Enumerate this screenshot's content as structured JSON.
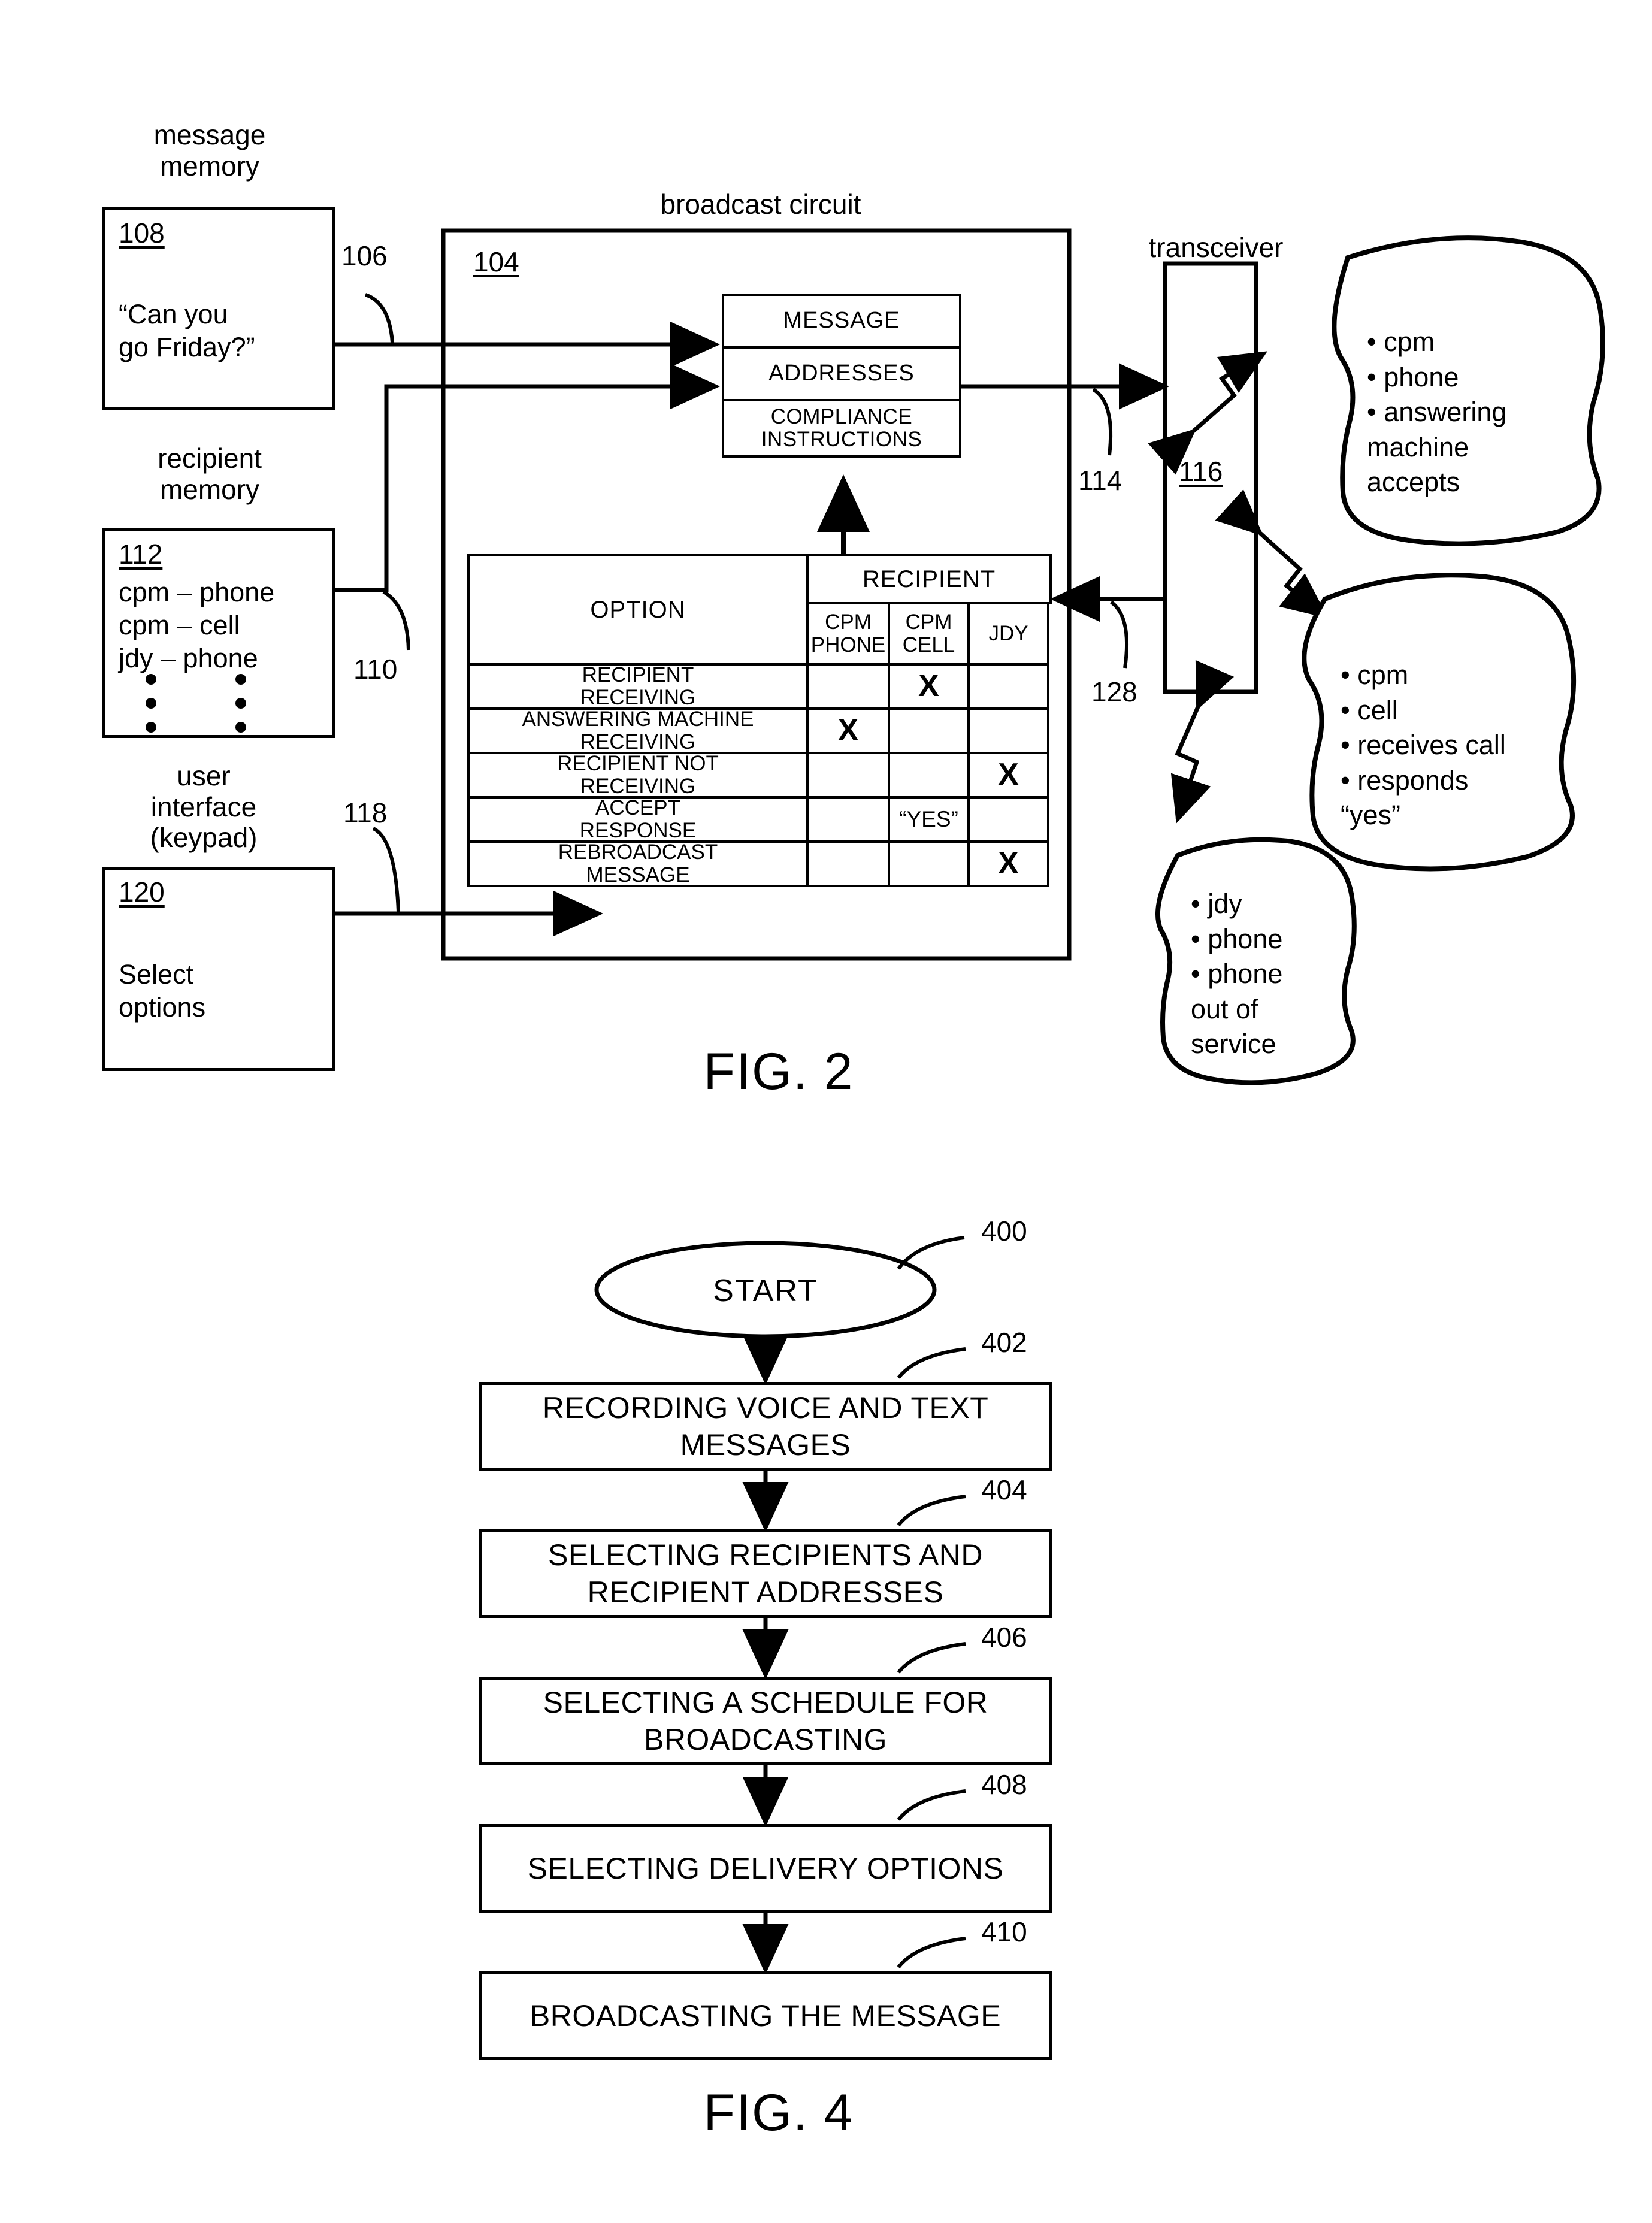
{
  "figures": [
    {
      "caption": "FIG. 2"
    },
    {
      "caption": "FIG. 4"
    }
  ],
  "fig2": {
    "caption": "FIG. 2",
    "message_memory": {
      "title": "message\nmemory",
      "ref": "108",
      "content": "“Can you\ngo Friday?”"
    },
    "recipient_memory": {
      "title": "recipient\nmemory",
      "ref": "112",
      "content": "cpm – phone\ncpm – cell\njdy – phone"
    },
    "user_interface": {
      "title": "user\ninterface\n(keypad)",
      "ref": "120",
      "content": "Select\noptions"
    },
    "broadcast_circuit": {
      "title": "broadcast circuit",
      "ref": "104",
      "packet": {
        "rows": [
          "MESSAGE",
          "ADDRESSES",
          "COMPLIANCE\nINSTRUCTIONS"
        ]
      }
    },
    "transceiver": {
      "title": "transceiver",
      "ref": "116"
    },
    "signal_refs": {
      "message_line": "106",
      "recipient_line": "110",
      "ui_line": "118",
      "out_line": "114",
      "in_line": "128"
    },
    "option_table": {
      "col_option": "OPTION",
      "col_group": "RECIPIENT",
      "subcols": [
        "CPM\nPHONE",
        "CPM\nCELL",
        "JDY"
      ],
      "rows": [
        {
          "option": "RECIPIENT\nRECEIVING",
          "cells": [
            "",
            "X",
            ""
          ]
        },
        {
          "option": "ANSWERING MACHINE\nRECEIVING",
          "cells": [
            "X",
            "",
            ""
          ]
        },
        {
          "option": "RECIPIENT NOT\nRECEIVING",
          "cells": [
            "",
            "",
            "X"
          ]
        },
        {
          "option": "ACCEPT\nRESPONSE",
          "cells": [
            "",
            "“YES”",
            ""
          ]
        },
        {
          "option": "REBROADCAST\nMESSAGE",
          "cells": [
            "",
            "",
            "X"
          ]
        }
      ]
    },
    "callouts": [
      {
        "name": "answering-machine-accepts",
        "lines": "• cpm\n• phone\n• answering\nmachine\naccepts"
      },
      {
        "name": "cell-responds-yes",
        "lines": "• cpm\n• cell\n• receives call\n• responds\n“yes”"
      },
      {
        "name": "phone-out-of-service",
        "lines": "• jdy\n• phone\n• phone\nout of\nservice"
      }
    ]
  },
  "fig4": {
    "caption": "FIG. 4",
    "start": {
      "label": "START",
      "ref": "400"
    },
    "steps": [
      {
        "label": "RECORDING VOICE AND TEXT\nMESSAGES",
        "ref": "402"
      },
      {
        "label": "SELECTING RECIPIENTS AND\nRECIPIENT ADDRESSES",
        "ref": "404"
      },
      {
        "label": "SELECTING A SCHEDULE FOR\nBROADCASTING",
        "ref": "406"
      },
      {
        "label": "SELECTING DELIVERY OPTIONS",
        "ref": "408"
      },
      {
        "label": "BROADCASTING THE MESSAGE",
        "ref": "410"
      }
    ]
  },
  "colors": {
    "ink": "#000000",
    "paper": "#ffffff"
  }
}
